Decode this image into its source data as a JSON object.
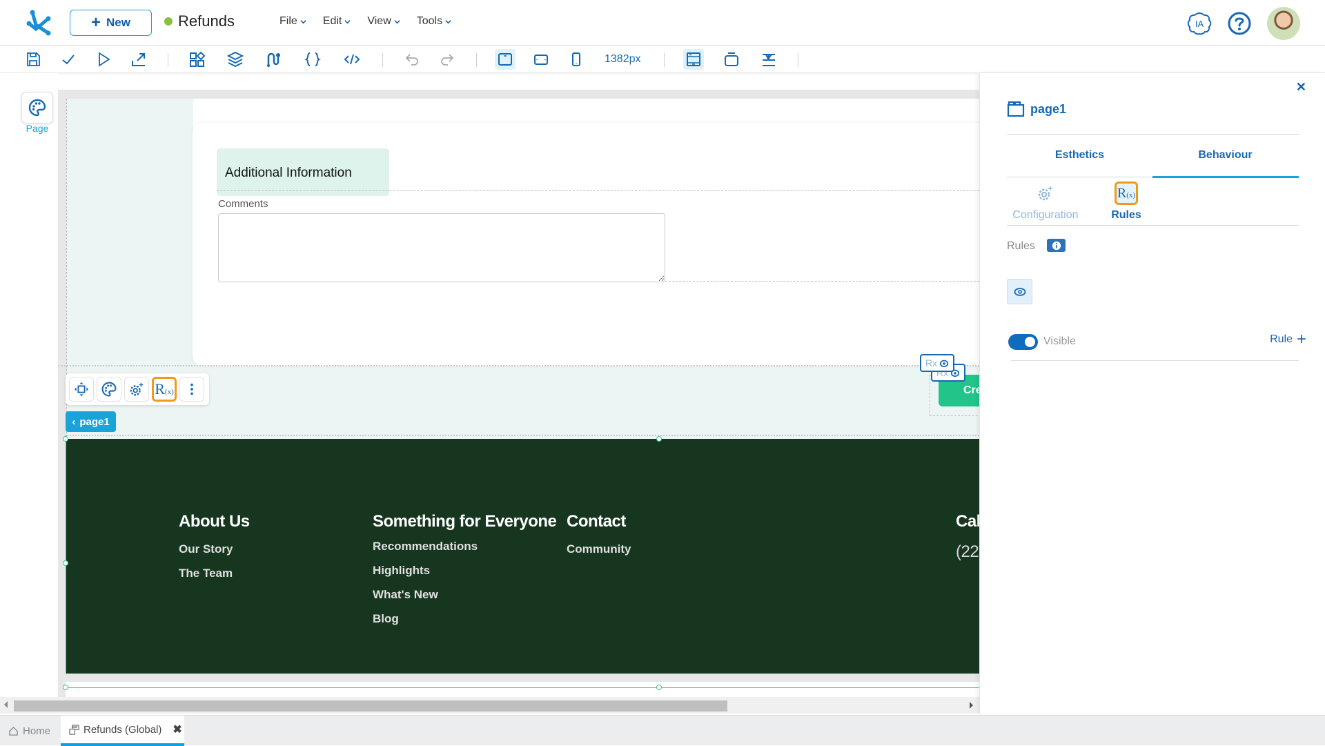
{
  "header": {
    "new_label": "New",
    "app_title": "Refunds",
    "status_color": "#8bbf3c",
    "menu": [
      {
        "label": "File"
      },
      {
        "label": "Edit"
      },
      {
        "label": "View"
      },
      {
        "label": "Tools"
      }
    ],
    "ia_label": "IA"
  },
  "toolbar": {
    "width_value": "1382px",
    "icons": [
      "save-icon",
      "check-icon",
      "play-icon",
      "export-icon",
      "components-icon",
      "layers-icon",
      "flow-icon",
      "braces-icon",
      "code-icon",
      "undo-icon",
      "redo-icon",
      "desktop-icon",
      "tablet-icon",
      "mobile-icon",
      "layout-page-icon",
      "layout-container-icon",
      "layout-align-icon"
    ]
  },
  "left_rail": {
    "page_label": "Page"
  },
  "canvas": {
    "section_title": "Additional Information",
    "comments_label": "Comments",
    "comments_value": "",
    "breadcrumb_chip": "page1",
    "rx_badge_label": "Rx",
    "create_button_partial": "Cre",
    "footer": {
      "columns": [
        {
          "heading": "About Us",
          "links": [
            "Our Story",
            "The Team"
          ]
        },
        {
          "heading": "Something for Everyone",
          "links": [
            "Recommendations",
            "Highlights",
            "What's New",
            "Blog"
          ]
        },
        {
          "heading": "Contact",
          "links": [
            "Community"
          ]
        },
        {
          "heading": "Cal",
          "links": [
            "(22"
          ]
        }
      ],
      "bg_color": "#173620"
    }
  },
  "panel": {
    "title": "page1",
    "tabs": [
      {
        "label": "Esthetics",
        "active": false
      },
      {
        "label": "Behaviour",
        "active": true
      }
    ],
    "subtabs": [
      {
        "label": "Configuration",
        "active": false
      },
      {
        "label": "Rules",
        "active": true
      }
    ],
    "rules_label": "Rules",
    "visible_label": "Visible",
    "visible_on": true,
    "add_rule_label": "Rule"
  },
  "bottom_tabs": [
    {
      "label": "Home",
      "active": false
    },
    {
      "label": "Refunds (Global)",
      "active": true
    }
  ],
  "colors": {
    "accent": "#1668b2",
    "accent_light": "#1aa3d9",
    "highlight": "#f09a1a"
  }
}
